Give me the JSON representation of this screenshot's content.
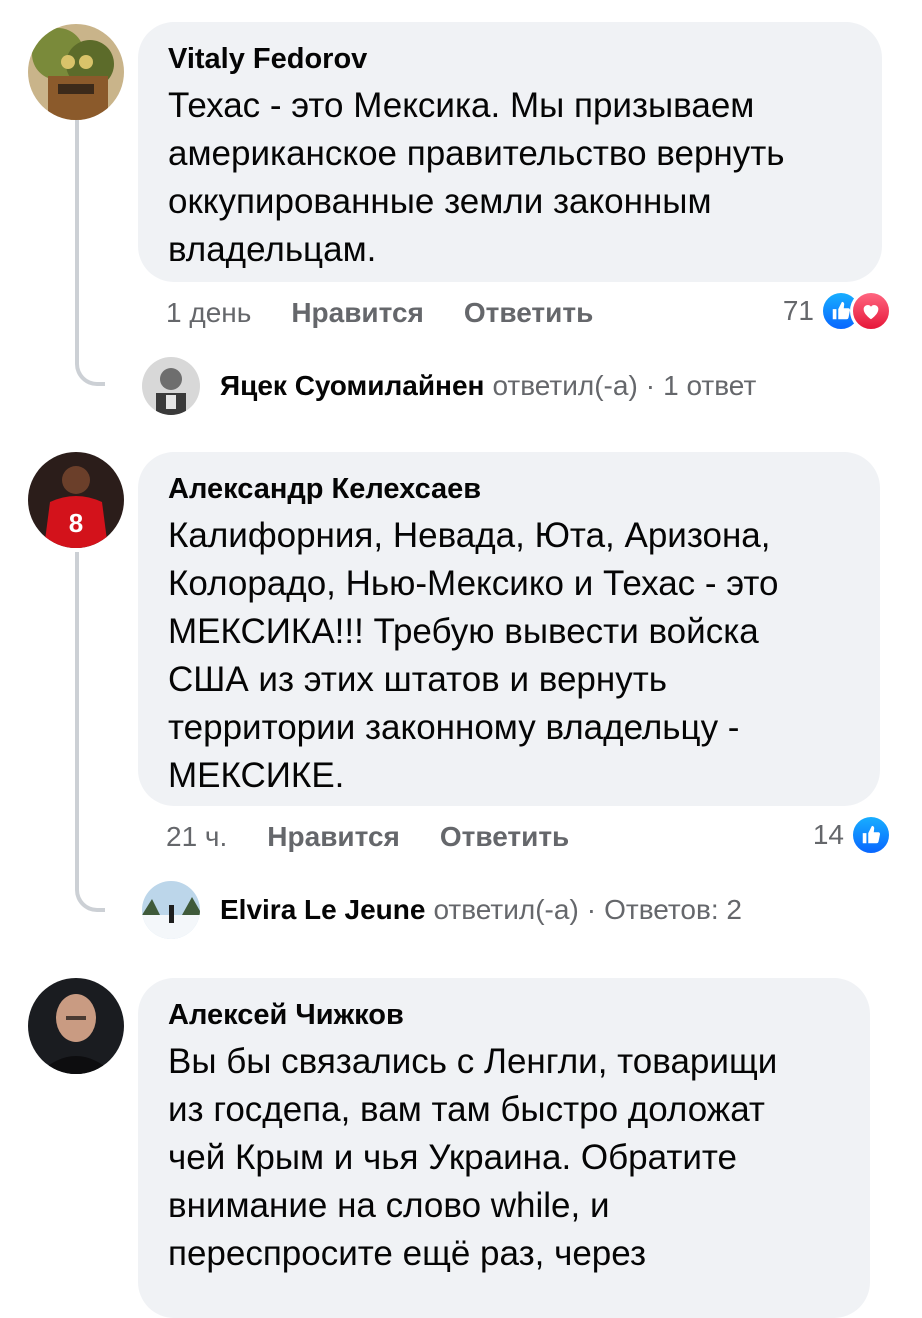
{
  "comments": [
    {
      "author": "Vitaly Fedorov",
      "text": "Техас - это Мексика. Мы призываем\nамериканское правительство вернуть\nоккупированные земли законным\nвладельцам.",
      "time": "1 день",
      "like_label": "Нравится",
      "reply_label": "Ответить",
      "reaction_count": "71",
      "reactions": [
        "like-icon",
        "love-icon"
      ],
      "reply": {
        "name": "Яцек Суомилайнен",
        "action": "ответил(-а)",
        "dot": "·",
        "count_text": "1 ответ"
      }
    },
    {
      "author": "Александр Келехсаев",
      "text": "Калифорния, Невада, Юта, Аризона,\nКолорадо, Нью-Мексико и Техас - это\nМЕКСИКА!!! Требую вывести войска\nСША из этих штатов и вернуть\nтерритории законному владельцу -\nМЕКСИКЕ.",
      "time": "21 ч.",
      "like_label": "Нравится",
      "reply_label": "Ответить",
      "reaction_count": "14",
      "reactions": [
        "like-icon"
      ],
      "reply": {
        "name": "Elvira Le Jeune",
        "action": "ответил(-а)",
        "dot": "·",
        "count_text": "Ответов: 2"
      }
    },
    {
      "author": "Алексей Чижков",
      "text": "Вы бы связались с Ленгли, товарищи\nиз госдепа, вам там быстро доложат\nчей Крым и чья Украина. Обратите\nвнимание на слово while, и\nпереспросите ещё раз, через"
    }
  ],
  "colors": {
    "bubble": "#f0f2f5",
    "secondary_text": "#65676b",
    "like_blue": "#0866ff",
    "love_red": "#e61739"
  }
}
